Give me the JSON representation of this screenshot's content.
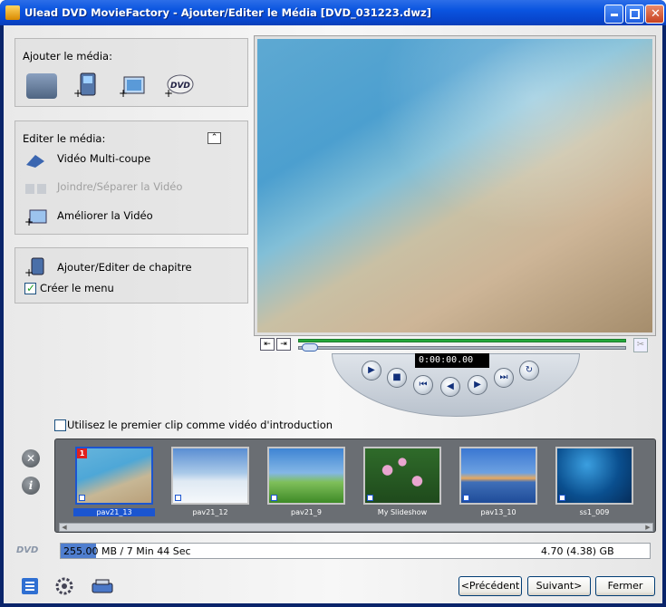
{
  "window": {
    "title": "Ulead DVD MovieFactory - Ajouter/Editer le Média [DVD_031223.dwz]"
  },
  "add_media": {
    "label": "Ajouter le média:",
    "icons": [
      "video-capture-icon",
      "add-video-icon",
      "add-image-icon",
      "add-dvd-icon"
    ]
  },
  "edit_media": {
    "label": "Editer le média:",
    "items": [
      {
        "label": "Vidéo Multi-coupe",
        "enabled": true,
        "icon": "multitrim-icon"
      },
      {
        "label": "Joindre/Séparer la Vidéo",
        "enabled": false,
        "icon": "join-split-icon"
      },
      {
        "label": "Améliorer la Vidéo",
        "enabled": true,
        "icon": "enhance-video-icon"
      }
    ]
  },
  "chapters": {
    "label": "Ajouter/Editer de chapitre",
    "create_menu": {
      "label": "Créer le menu",
      "checked": true
    }
  },
  "player": {
    "timecode": "0:00:00.00"
  },
  "intro_checkbox": {
    "label": "Utilisez le premier clip comme vidéo d'introduction",
    "checked": false
  },
  "clips": [
    {
      "label": "pav21_13",
      "badge": "1",
      "selected": true
    },
    {
      "label": "pav21_12",
      "selected": false
    },
    {
      "label": "pav21_9",
      "selected": false
    },
    {
      "label": "My Slideshow",
      "selected": false
    },
    {
      "label": "pav13_10",
      "selected": false
    },
    {
      "label": "ss1_009",
      "selected": false
    }
  ],
  "status": {
    "dvd_label": "DVD",
    "used": "255.00 MB / 7 Min 44 Sec",
    "capacity": "4.70 (4.38) GB",
    "fill_fraction": 0.06
  },
  "buttons": {
    "prev": "<Précédent",
    "next": "Suivant>",
    "close": "Fermer"
  },
  "colors": {
    "accent": "#1b55d0",
    "titlebar": "#0a54e0",
    "check": "#21a121"
  }
}
